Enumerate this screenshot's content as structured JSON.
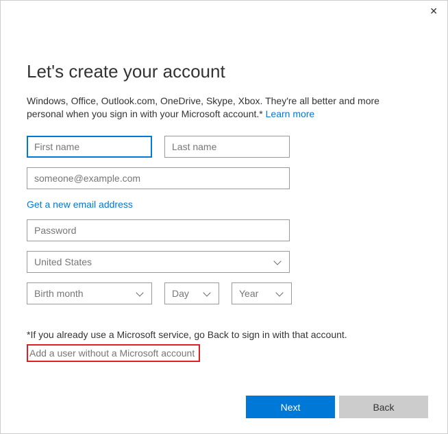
{
  "heading": "Let's create your account",
  "description": "Windows, Office, Outlook.com, OneDrive, Skype, Xbox. They're all better and more personal when you sign in with your Microsoft account.* ",
  "learn_more": "Learn more",
  "fields": {
    "first_name": "First name",
    "last_name": "Last name",
    "email": "someone@example.com",
    "password": "Password",
    "country": "United States",
    "birth_month": "Birth month",
    "birth_day": "Day",
    "birth_year": "Year"
  },
  "links": {
    "new_email": "Get a new email address",
    "alt_account": "Add a user without a Microsoft account"
  },
  "footnote": "*If you already use a Microsoft service, go Back to sign in with that account.",
  "buttons": {
    "next": "Next",
    "back": "Back"
  },
  "colors": {
    "accent": "#0078d7",
    "highlight_border": "#e02020"
  }
}
